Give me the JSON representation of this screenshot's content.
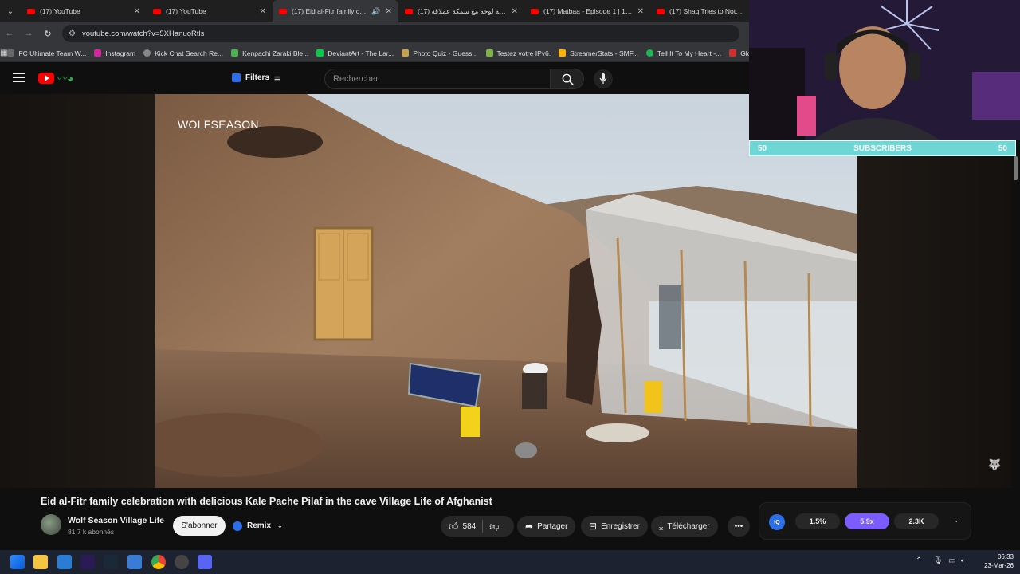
{
  "browser": {
    "tabs": [
      {
        "title": "(17) YouTube",
        "active": false
      },
      {
        "title": "(17) YouTube",
        "active": false
      },
      {
        "title": "(17) Eid al-Fitr family celebr",
        "active": true
      },
      {
        "title": "(17) كنت وجه لوجه مع سمكة عملاقة",
        "active": false
      },
      {
        "title": "(17) Matbaa - Episode 1 | 1 الحلقة",
        "active": false
      },
      {
        "title": "(17) Shaq Tries to Not Make",
        "active": false
      }
    ],
    "url": "youtube.com/watch?v=5XHanuoRtls",
    "bookmarks": [
      {
        "label": "FC Ultimate Team W...",
        "color": "#666666"
      },
      {
        "label": "Instagram",
        "color": "#d6249f"
      },
      {
        "label": "Kick Chat Search Re...",
        "color": "#888888"
      },
      {
        "label": "Kenpachi Zaraki Ble...",
        "color": "#4caf50"
      },
      {
        "label": "DeviantArt - The Lar...",
        "color": "#05cc47"
      },
      {
        "label": "Photo Quiz - Guess...",
        "color": "#c8a24a"
      },
      {
        "label": "Testez votre IPv6.",
        "color": "#7cb342"
      },
      {
        "label": "StreamerStats - SMF...",
        "color": "#ffb300"
      },
      {
        "label": "Tell It To My Heart -...",
        "color": "#1db954"
      },
      {
        "label": "Globa",
        "color": "#d32f2f"
      }
    ]
  },
  "youtube": {
    "filters_label": "Filters",
    "search_placeholder": "Rechercher"
  },
  "video": {
    "watermark": "WOLFSEASON",
    "title": "Eid al-Fitr family celebration with delicious Kale Pache Pilaf in the cave Village Life of Afghanist",
    "channel_name": "Wolf Season Village Life",
    "channel_subs": "81,7 k abonnés",
    "subscribe_label": "S'abonner",
    "remix_label": "Remix",
    "likes": "584",
    "share_label": "Partager",
    "save_label": "Enregistrer",
    "download_label": "Télécharger"
  },
  "overlay": {
    "subs_left": "50",
    "subs_label": "SUBSCRIBERS",
    "subs_right": "50"
  },
  "stats": {
    "values": [
      "1.5%",
      "5.9x",
      "2.3K"
    ]
  },
  "clock": {
    "time": "06:33",
    "date": "23-Mar-26"
  }
}
